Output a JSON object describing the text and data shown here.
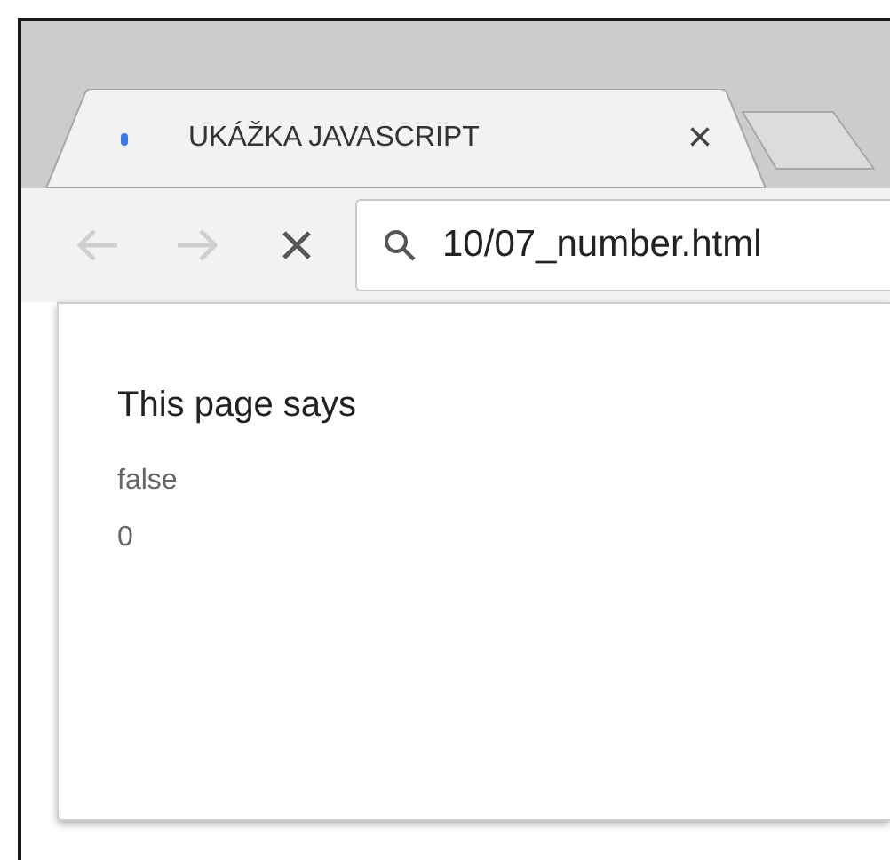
{
  "tabs": [
    {
      "title": "UKÁŽKA JAVASCRIPT",
      "close": "×",
      "selected": true,
      "loading": true
    }
  ],
  "toolbar": {
    "back": {
      "disabled": true
    },
    "forward": {
      "disabled": true
    },
    "stop": {
      "disabled": false
    }
  },
  "address_bar": {
    "value": "10/07_number.html"
  },
  "dialog": {
    "title": "This page says",
    "lines": [
      "false",
      "0"
    ]
  }
}
